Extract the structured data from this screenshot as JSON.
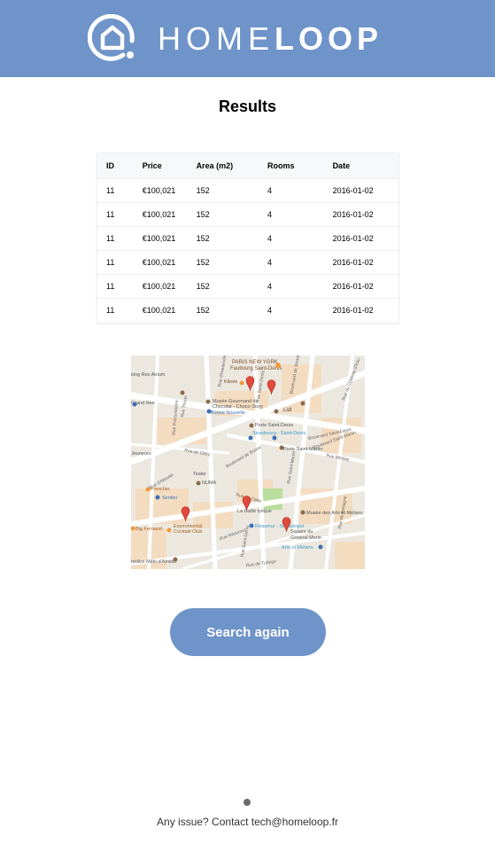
{
  "header": {
    "brand_light": "HOME",
    "brand_bold": "LOOP",
    "logo_icon": "house-in-circle-icon",
    "bg_color": "#6f94c9"
  },
  "page": {
    "title": "Results"
  },
  "table": {
    "columns": [
      "ID",
      "Price",
      "Area (m2)",
      "Rooms",
      "Date"
    ],
    "rows": [
      [
        "11",
        "€100,021",
        "152",
        "4",
        "2016-01-02"
      ],
      [
        "11",
        "€100,021",
        "152",
        "4",
        "2016-01-02"
      ],
      [
        "11",
        "€100,021",
        "152",
        "4",
        "2016-01-02"
      ],
      [
        "11",
        "€100,021",
        "152",
        "4",
        "2016-01-02"
      ],
      [
        "11",
        "€100,021",
        "152",
        "4",
        "2016-01-02"
      ],
      [
        "11",
        "€100,021",
        "152",
        "4",
        "2016-01-02"
      ]
    ]
  },
  "map": {
    "labels": {
      "paris_ny": "PARIS NEW YORK",
      "faubourg": "Faubourg Saint-Denis",
      "kibele": "Kibele",
      "rex": "king Rex Atrium",
      "grand_rex": "Grand Rex",
      "gourmand1": "Musée Gourmand du",
      "gourmand2": "Chocolat - Choco-Story",
      "bonne": "Bonne Nouvelle",
      "lidl": "Lidl",
      "porte_sd": "Porte Saint-Denis",
      "strasbourg": "Strasbourg - Saint-Denis",
      "porte_sm": "Porte Saint-Martin",
      "teeler": "Tealer",
      "numa": "NUMA",
      "frenchie": "Frenchie",
      "sentier": "Sentier",
      "gaite": "La Gaîté lyrique",
      "arts_metiers": "Musée des Arts et Métiers",
      "big_fernand": "Big Fernand",
      "experimental1": "Experimental",
      "experimental2": "Cocktail Club",
      "reaumur": "Réaumur - Sébastopol",
      "square1": "Square du",
      "square2": "Général Morin",
      "arts_metro": "Arts et Métiers",
      "theatre": "héâtre Mélo d'Amélie",
      "bd_strasbourg": "Boulevard de Strasbourg",
      "rue_sd": "Rue Saint-Denis",
      "bd_sd": "Boulevard Saint-Denis",
      "rue_chateau": "Rue du Château d'Eau",
      "rue_turbigo": "Rue de Turbigo",
      "rue_aboukir": "Rue d'Aboukir",
      "rue_sm": "Rue Saint-Martin",
      "rue_hauteville": "Rue d'Hauteville",
      "rue_poissonniere": "Rue Poissonnière",
      "rue_reaumur": "Rue Réaumur",
      "rue_meslay": "Rue Meslay",
      "bd_st_martin": "Boulevard Saint-Martin",
      "rue_clery": "Rue de Cléry",
      "jeuneurs": "Jeuneurs",
      "rue_thorel": "Rue Thorel",
      "rue_sd2": "Rue Saint-Denis",
      "rue_bouchard": "Boulevard de Bonne",
      "rue_caire": "Rue du Caire",
      "rue_bretagne": "Rue de Bretagne"
    },
    "colors": {
      "road": "#ffffff",
      "land": "#ece8e0",
      "block": "#f3dcc0",
      "park": "#b9dd9c",
      "pin": "#e04a3a"
    },
    "pins": 5
  },
  "actions": {
    "search_again": "Search again"
  },
  "footer": {
    "contact": "Any issue? Contact tech@homeloop.fr"
  }
}
